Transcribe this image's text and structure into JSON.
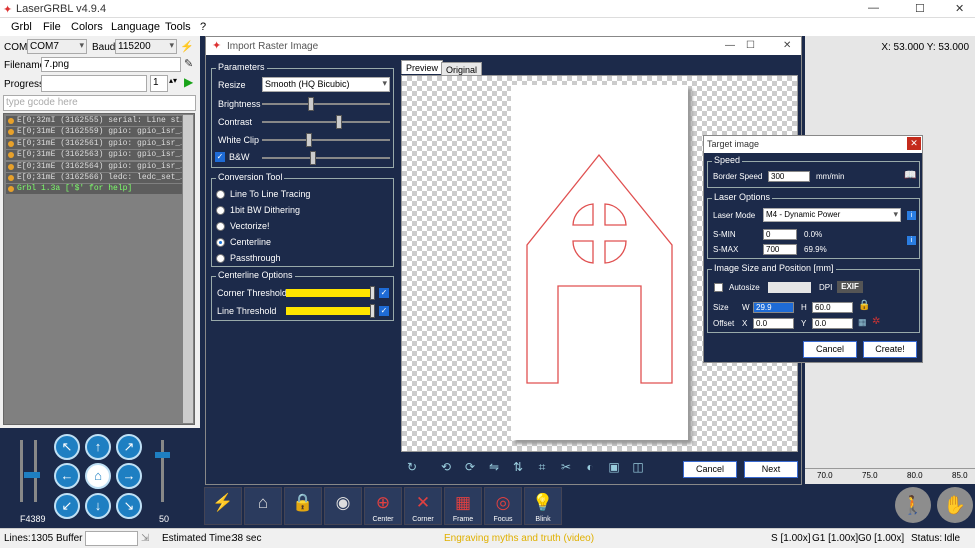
{
  "window": {
    "title": "LaserGRBL v4.9.4",
    "min": "—",
    "max": "☐",
    "close": "✕"
  },
  "menu": [
    "Grbl",
    "File",
    "Colors",
    "Language",
    "Tools",
    "?"
  ],
  "conn": {
    "com_label": "COM",
    "com_value": "COM7",
    "baud_label": "Baud",
    "baud_value": "115200"
  },
  "file": {
    "label": "Filename",
    "value": "7.png"
  },
  "progress": {
    "label": "Progress",
    "count": "1"
  },
  "gcode_input": {
    "placeholder": "type gcode here"
  },
  "console": [
    {
      "text": "E[0;32mI (3162555) serial: Line st…",
      "ok": false
    },
    {
      "text": "E[0;31mE (3162559) gpio: gpio_isr_…",
      "ok": false
    },
    {
      "text": "E[0;31mE (3162561) gpio: gpio_isr_…",
      "ok": false
    },
    {
      "text": "E[0;31mE (3162563) gpio: gpio_isr_…",
      "ok": false
    },
    {
      "text": "E[0;31mE (3162564) gpio: gpio_isr_…",
      "ok": false
    },
    {
      "text": "E[0;31mE (3162566) ledc: ledc_set_…",
      "ok": false
    },
    {
      "text": "Grbl 1.3a ['$' for help]",
      "ok": true
    }
  ],
  "jog": {
    "feed": "F4389",
    "step": "50"
  },
  "coords": "X: 53.000 Y: 53.000",
  "ruler": {
    "t1": "70.0",
    "t2": "75.0",
    "t3": "80.0",
    "t4": "85.0"
  },
  "dialog": {
    "title": "Import Raster Image",
    "params_title": "Parameters",
    "resize_label": "Resize",
    "resize_value": "Smooth (HQ Bicubic)",
    "brightness": "Brightness",
    "contrast": "Contrast",
    "whiteclip": "White Clip",
    "bw": "B&W",
    "levels": {
      "brightness": 0.38,
      "contrast": 0.6,
      "whiteclip": 0.37,
      "bw": 0.4
    },
    "conv_title": "Conversion Tool",
    "conv_options": [
      "Line To Line Tracing",
      "1bit BW Dithering",
      "Vectorize!",
      "Centerline",
      "Passthrough"
    ],
    "conv_selected": 3,
    "center_title": "Centerline Options",
    "corner": "Corner Threshold",
    "line": "Line Threshold",
    "tab_preview": "Preview",
    "tab_original": "Original",
    "cancel": "Cancel",
    "next": "Next"
  },
  "target": {
    "title": "Target image",
    "close": "✕",
    "speed_title": "Speed",
    "border_speed_label": "Border Speed",
    "border_speed": "300",
    "speed_unit": "mm/min",
    "laser_title": "Laser Options",
    "mode_label": "Laser Mode",
    "mode_value": "M4 - Dynamic Power",
    "smin_label": "S-MIN",
    "smin": "0",
    "smin_pct": "0.0%",
    "smax_label": "S-MAX",
    "smax": "700",
    "smax_pct": "69.9%",
    "size_title": "Image Size and Position [mm]",
    "autosize": "Autosize",
    "dpi": "DPI",
    "exif": "EXIF",
    "size_label": "Size",
    "w_label": "W",
    "w": "29.9",
    "h_label": "H",
    "h": "60.0",
    "offset_label": "Offset",
    "x_label": "X",
    "x": "0.0",
    "y_label": "Y",
    "y": "0.0",
    "cancel": "Cancel",
    "create": "Create!"
  },
  "tools": [
    {
      "label": "",
      "icon": "lightning-icon"
    },
    {
      "label": "",
      "icon": "home-search-icon"
    },
    {
      "label": "",
      "icon": "lock-icon"
    },
    {
      "label": "",
      "icon": "globe-pin-icon"
    },
    {
      "label": "Center",
      "icon": "center-icon"
    },
    {
      "label": "Corner",
      "icon": "corner-icon"
    },
    {
      "label": "Frame",
      "icon": "frame-icon"
    },
    {
      "label": "Focus",
      "icon": "focus-icon"
    },
    {
      "label": "Blink",
      "icon": "bulb-icon"
    }
  ],
  "status": {
    "lines_label": "Lines:",
    "lines": "1305",
    "buffer_label": "Buffer",
    "est_label": "Estimated Time:",
    "est": "38 sec",
    "message": "Engraving myths and truth (video)",
    "s": "S [1.00x]",
    "g1": "G1 [1.00x]",
    "g0": "G0 [1.00x]",
    "state": "Status:",
    "state_value": "Idle"
  },
  "colors": {
    "accent": "#1c2a4a",
    "outline": "#e05050",
    "status_msg": "#e0b000"
  }
}
